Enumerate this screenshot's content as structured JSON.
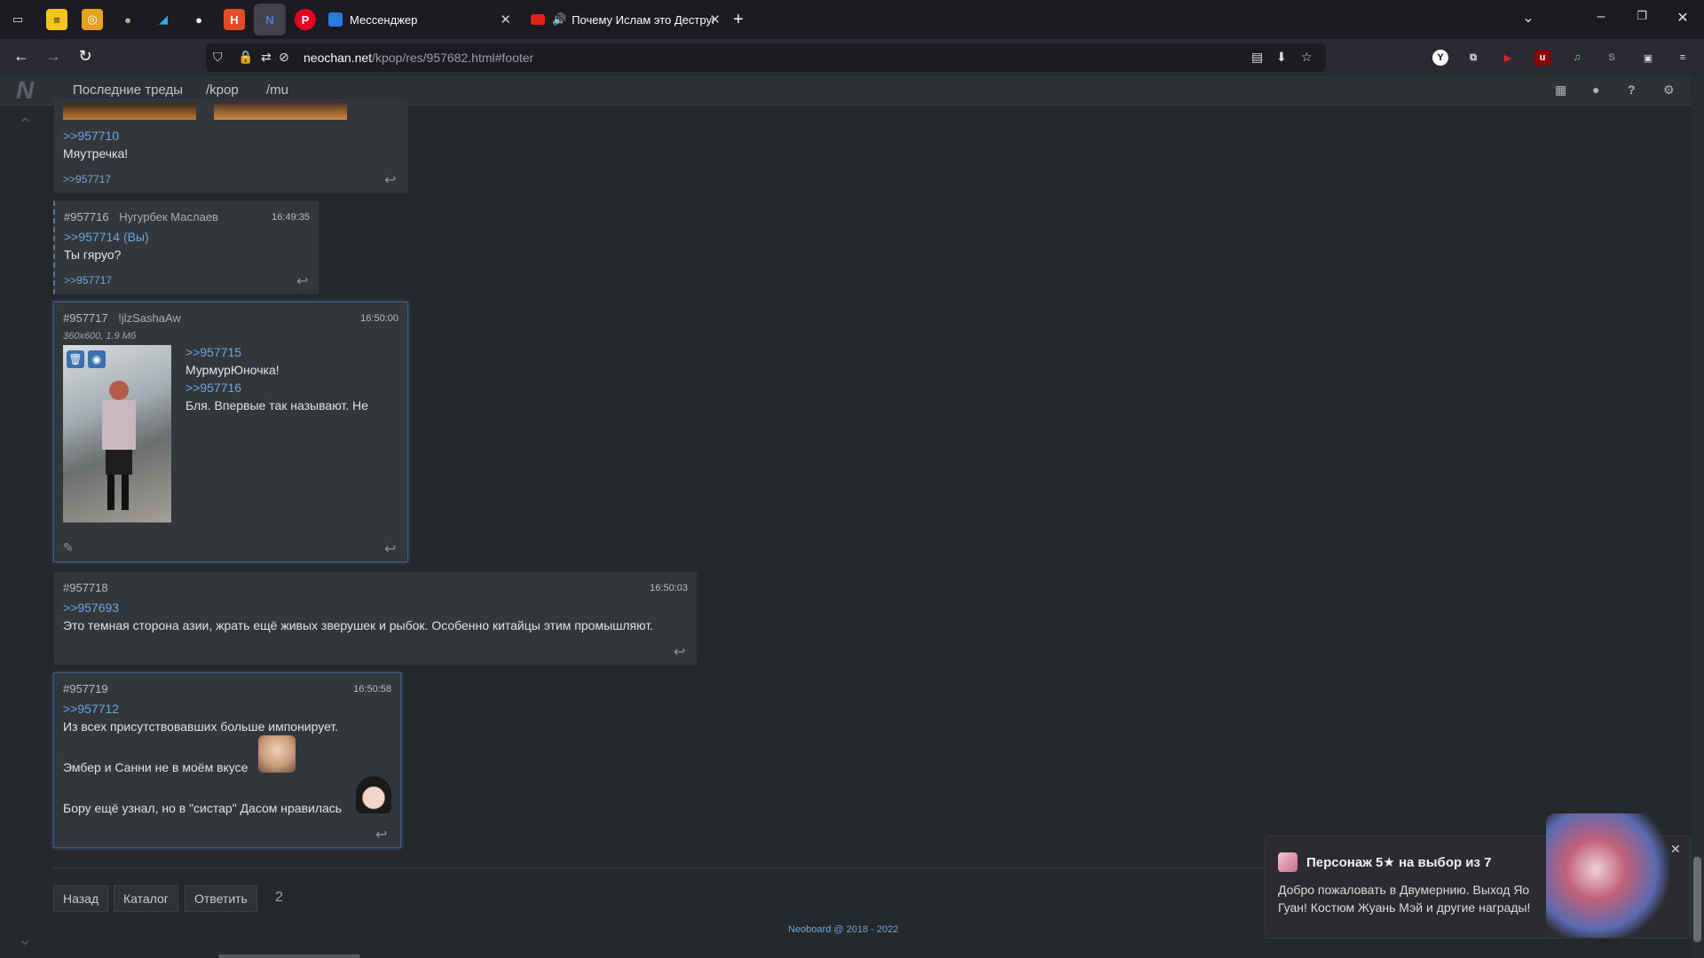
{
  "browser": {
    "tabs": [
      {
        "title": "Мессенджер"
      },
      {
        "title": "Почему Ислам это Деструкт"
      }
    ],
    "url_host": "neochan.net",
    "url_path": "/kpop/res/957682.html#footer"
  },
  "site": {
    "logo": "N",
    "nav": [
      "Последние треды",
      "/kpop",
      "/mu"
    ]
  },
  "posts": {
    "p710": {
      "quote": ">>957710",
      "text": "Мяутречка!",
      "reply": ">>957717"
    },
    "p716": {
      "num": "#957716",
      "name": "Нугурбек Маслаев",
      "time": "16:49:35",
      "quote": ">>957714 (Вы)",
      "text": "Ты гяруо?",
      "reply": ">>957717"
    },
    "p717": {
      "num": "#957717",
      "name": "!jlzSashaAw",
      "time": "16:50:00",
      "file_info": "360x600, 1.9 Мб",
      "quote1": ">>957715",
      "text1": "МурмурЮночка!",
      "quote2": ">>957716",
      "text2": "Бля. Впервые так называют. Не"
    },
    "p718": {
      "num": "#957718",
      "time": "16:50:03",
      "quote": ">>957693",
      "text": "Это темная сторона азии, жрать ещё живых зверушек и рыбок. Особенно китайцы этим промышляют."
    },
    "p719": {
      "num": "#957719",
      "time": "16:50:58",
      "quote": ">>957712",
      "text1": "Из всех присутствовавших больше импонирует.",
      "text2": "Эмбер и Санни не в моём вкусе",
      "text3": "Бору ещё узнал, но в \"систар\" Дасом нравилась"
    }
  },
  "footer": {
    "back": "Назад",
    "catalog": "Каталог",
    "reply": "Ответить",
    "page": "2",
    "copyright": "Neoboard @ 2018 - 2022"
  },
  "toast": {
    "title": "Персонаж 5★ на выбор из 7",
    "body": "Добро пожаловать в Двумернию. Выход Яо Гуан! Костюм Жуань Мэй и другие награды!"
  },
  "colors": {
    "link": "#6aa6dd",
    "post_bg": "#33373b",
    "page_bg": "#26292c"
  }
}
